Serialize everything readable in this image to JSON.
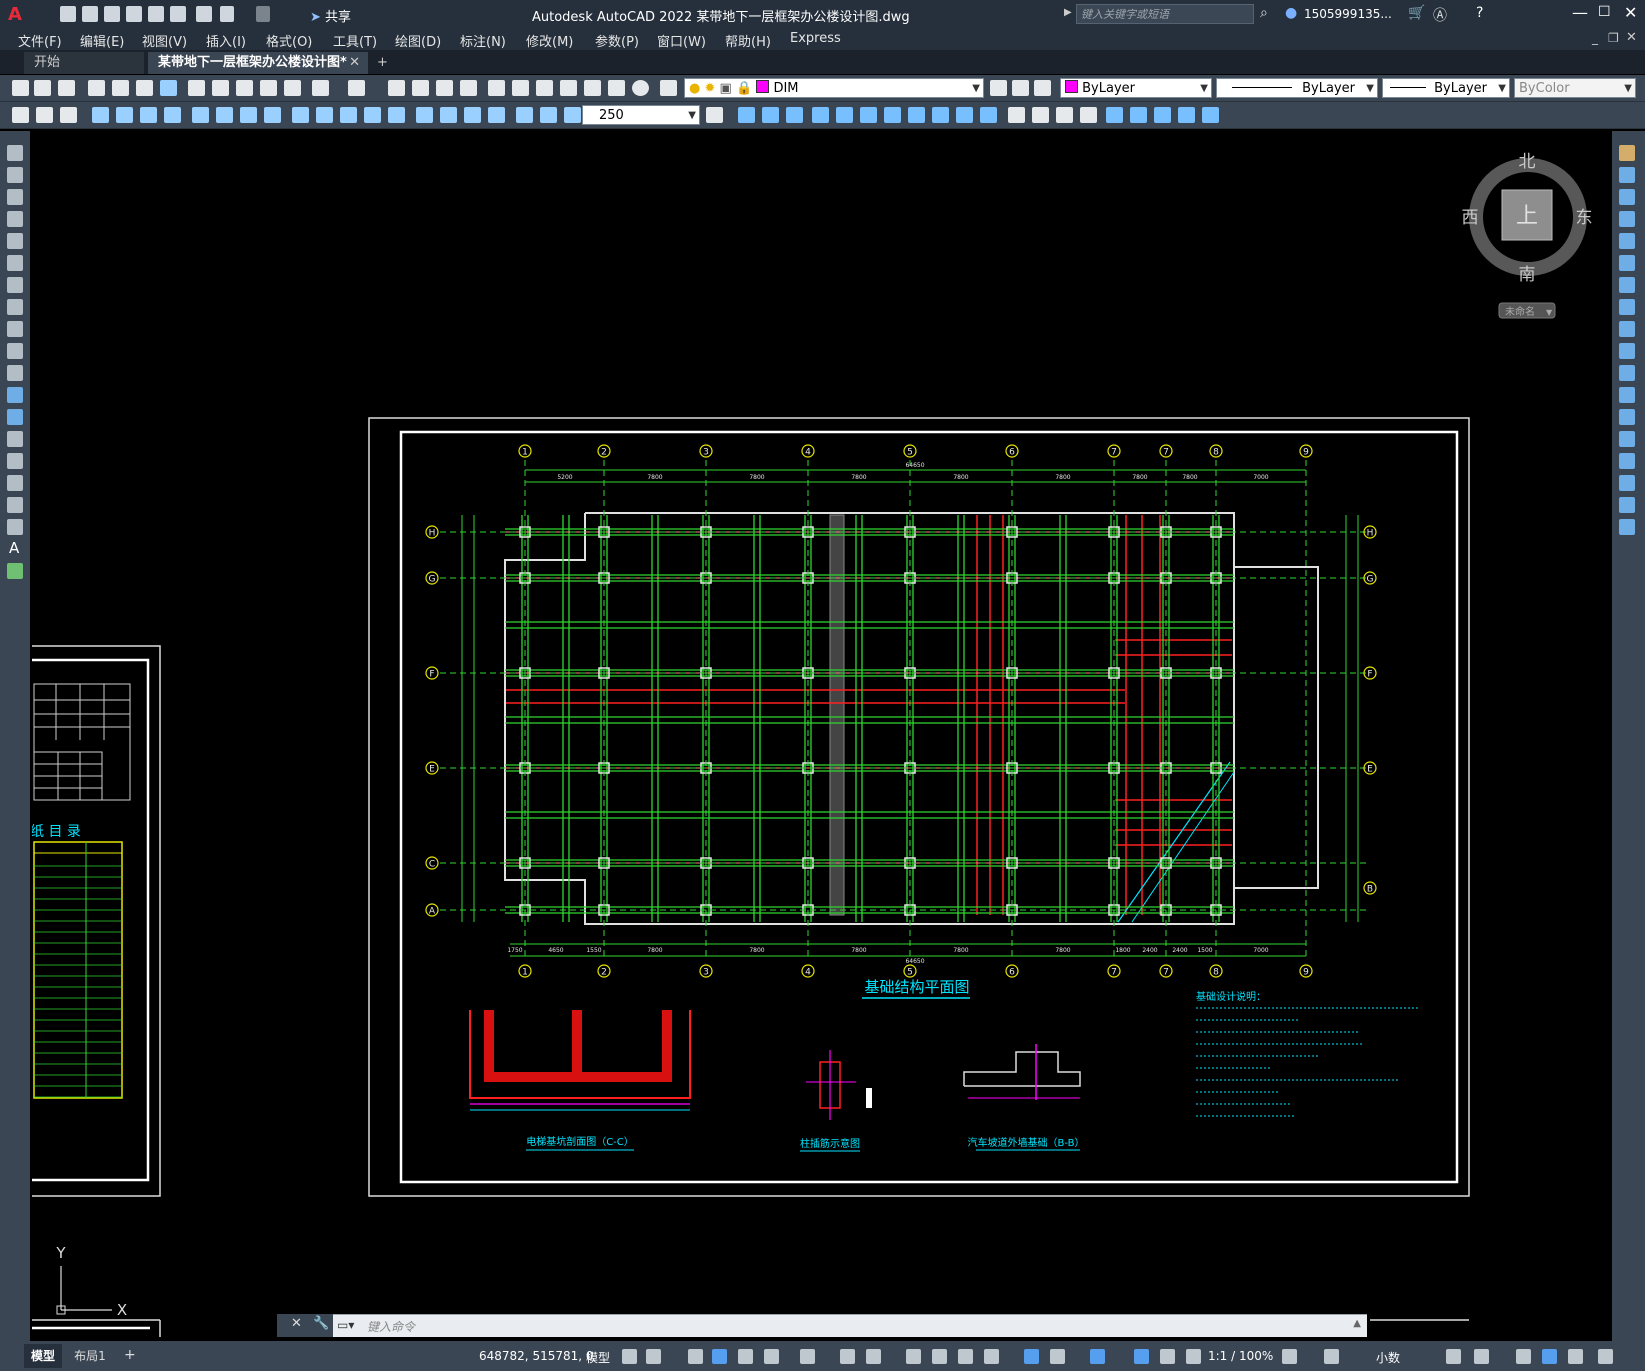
{
  "window": {
    "title": "Autodesk AutoCAD 2022    某带地下一层框架办公楼设计图.dwg",
    "search_placeholder": "键入关键字或短语",
    "user": "1505999135...",
    "share_label": "共享"
  },
  "menus": [
    "文件(F)",
    "编辑(E)",
    "视图(V)",
    "插入(I)",
    "格式(O)",
    "工具(T)",
    "绘图(D)",
    "标注(N)",
    "修改(M)",
    "参数(P)",
    "窗口(W)",
    "帮助(H)",
    "Express"
  ],
  "tabs": [
    {
      "label": "开始"
    },
    {
      "label": "某带地下一层框架办公楼设计图*"
    }
  ],
  "toolbar": {
    "layer_value": "DIM",
    "color_value": "ByLayer",
    "linetype_value": "ByLayer",
    "lineweight_value": "ByLayer",
    "plotstyle_value": "ByColor",
    "dim_scale_value": "250"
  },
  "viewcube": {
    "north": "北",
    "south": "南",
    "west": "西",
    "east": "东",
    "face": "上",
    "ucs_label": "未命名"
  },
  "drawing": {
    "main_title": "基础结构平面图",
    "detail_1": "电梯基坑剖面图（C-C）",
    "detail_2": "柱插筋示意图",
    "detail_3": "汽车坡道外墙基础（B-B）",
    "notes_title": "基础设计说明：",
    "left_sheet_title": "纸 目 录",
    "axis_top": [
      "1",
      "2",
      "3",
      "4",
      "5",
      "6",
      "7",
      "7",
      "8",
      "9"
    ],
    "axis_left": [
      "H",
      "G",
      "F",
      "E",
      "C",
      "A"
    ],
    "axis_right": [
      "H",
      "G",
      "F",
      "E",
      "B"
    ],
    "dim_top": [
      "5200",
      "7800",
      "7800",
      "7800",
      "7800",
      "7800",
      "7800",
      "7800",
      "7000"
    ],
    "dim_bottom": [
      "1750",
      "4650",
      "1550",
      "7800",
      "7800",
      "7800",
      "7800",
      "7800",
      "1800",
      "2400",
      "2400",
      "1500",
      "7000"
    ],
    "total_top": "64650",
    "total_bottom": "64650"
  },
  "ucs": {
    "x": "X",
    "y": "Y"
  },
  "command": {
    "placeholder": "键入命令"
  },
  "layout_tabs": [
    "模型",
    "布局1"
  ],
  "status": {
    "coords": "648782, 515781, 0",
    "model": "模型",
    "scale": "1:1 / 100%",
    "units": "小数"
  }
}
